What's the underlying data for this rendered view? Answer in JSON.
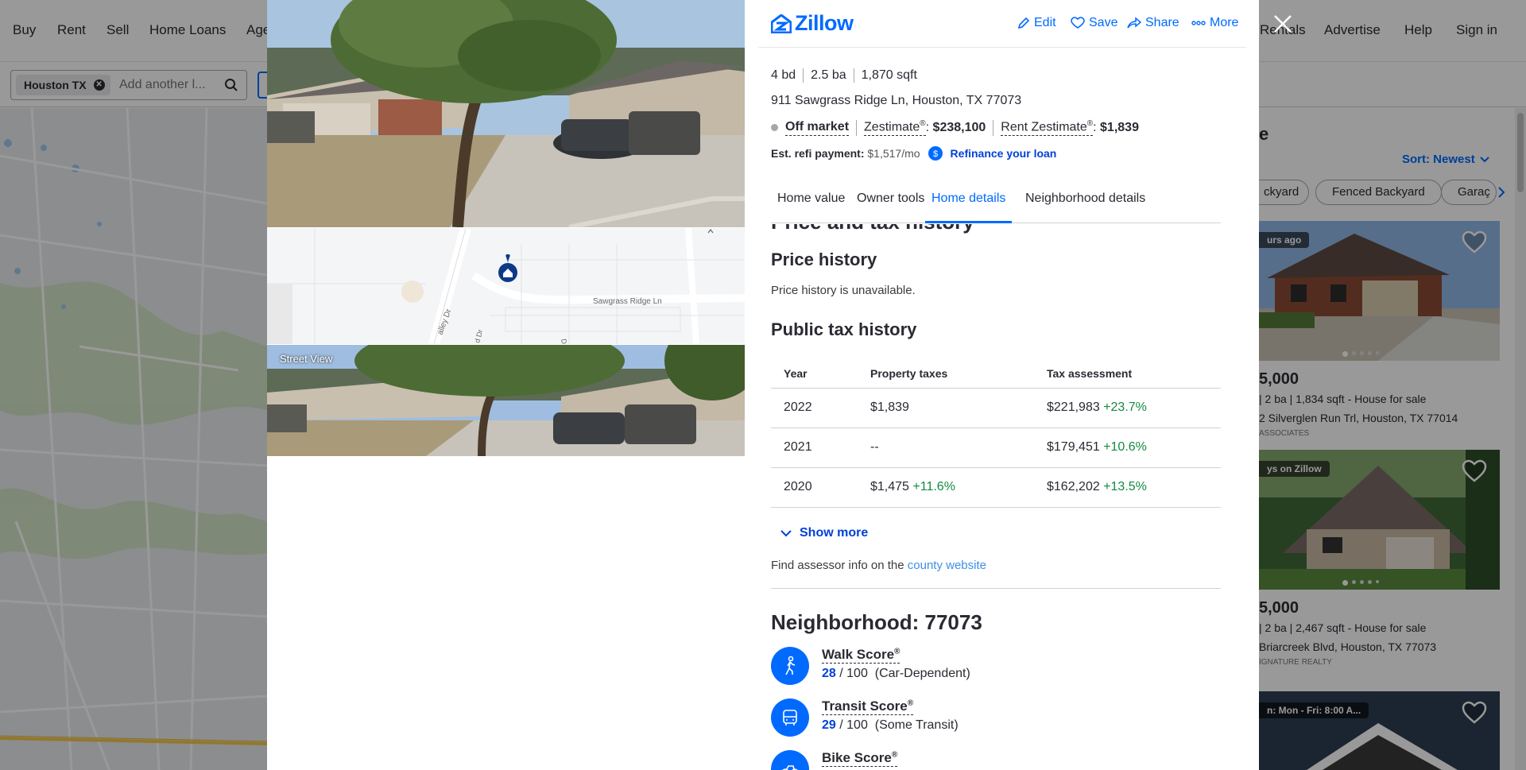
{
  "topnav": {
    "left_items": [
      "Buy",
      "Rent",
      "Sell",
      "Home Loans",
      "Age"
    ],
    "right_items": [
      "Rentals",
      "Advertise",
      "Help",
      "Sign in"
    ]
  },
  "search": {
    "chip": "Houston TX",
    "placeholder": "Add another l..."
  },
  "listings_pane": {
    "partial_heading": "e",
    "sort_label": "Sort: Newest",
    "filters": [
      "ckyard",
      "Fenced Backyard",
      "Garaç"
    ],
    "cards": [
      {
        "badge": "urs ago",
        "price": "5,000",
        "meta": "| 2 ba | 1,834 sqft - House for sale",
        "meta_bold_sqft": "1,834",
        "address": "2 Silverglen Run Trl, Houston, TX 77014",
        "broker": "ASSOCIATES"
      },
      {
        "badge": "ys on Zillow",
        "price": "5,000",
        "meta": "| 2 ba | 2,467 sqft - House for sale",
        "meta_bold_sqft": "2,467",
        "address": "Briarcreek Blvd, Houston, TX 77073",
        "broker": "IGNATURE REALTY"
      },
      {
        "badge": "n: Mon - Fri: 8:00 A...",
        "price": "",
        "meta": "",
        "address": "",
        "broker": ""
      }
    ]
  },
  "modal": {
    "logo": "Zillow",
    "actions": [
      "Edit",
      "Save",
      "Share",
      "More"
    ],
    "facts": [
      "4 bd",
      "2.5 ba",
      "1,870 sqft"
    ],
    "address": "911 Sawgrass Ridge Ln, Houston, TX 77073",
    "status": "Off market",
    "zestimate_label": "Zestimate",
    "zestimate_value": "$238,100",
    "rent_zestimate_label": "Rent Zestimate",
    "rent_zestimate_value": "$1,839",
    "refi_label": "Est. refi payment:",
    "refi_value": "$1,517/mo",
    "refi_link": "Refinance your loan",
    "tabs": [
      "Home value",
      "Owner tools",
      "Home details",
      "Neighborhood details"
    ],
    "active_tab": "Home details",
    "street_view_label": "Street View",
    "map_labels": [
      "Sawgrass Ridge Ln",
      "alley Dr",
      "d Dr",
      "D"
    ]
  },
  "content": {
    "cut_heading": "Price and tax history",
    "price_history_title": "Price history",
    "price_history_text": "Price history is unavailable.",
    "tax_history_title": "Public tax history",
    "tax_columns": [
      "Year",
      "Property taxes",
      "Tax assessment"
    ],
    "tax_rows": [
      {
        "year": "2022",
        "taxes": "$1,839",
        "taxes_change": "",
        "assessment": "$221,983",
        "assessment_change": "+23.7%"
      },
      {
        "year": "2021",
        "taxes": "--",
        "taxes_change": "",
        "assessment": "$179,451",
        "assessment_change": "+10.6%"
      },
      {
        "year": "2020",
        "taxes": "$1,475",
        "taxes_change": "+11.6%",
        "assessment": "$162,202",
        "assessment_change": "+13.5%"
      }
    ],
    "show_more": "Show more",
    "assessor_text": "Find assessor info on the",
    "assessor_link": "county website",
    "neighborhood_title": "Neighborhood: 77073",
    "scores": [
      {
        "title": "Walk Score",
        "value": "28",
        "max": "/ 100",
        "desc": "(Car-Dependent)"
      },
      {
        "title": "Transit Score",
        "value": "29",
        "max": "/ 100",
        "desc": "(Some Transit)"
      },
      {
        "title": "Bike Score",
        "value": "",
        "max": "",
        "desc": ""
      }
    ]
  },
  "colors": {
    "brand": "#006aff",
    "positive": "#138a41",
    "text": "#2a2a33"
  }
}
